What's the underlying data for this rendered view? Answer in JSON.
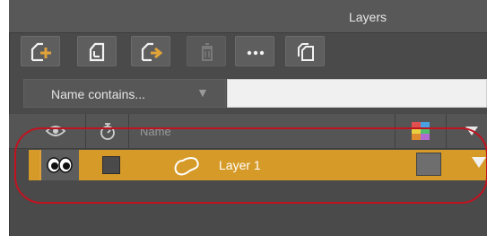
{
  "panel": {
    "title": "Layers"
  },
  "toolbar": {
    "buttons": [
      {
        "name": "new-layer",
        "icon": "new-layer-icon"
      },
      {
        "name": "duplicate-layer",
        "icon": "duplicate-layer-icon"
      },
      {
        "name": "move-layer",
        "icon": "move-layer-icon"
      },
      {
        "name": "delete-layer",
        "icon": "trash-icon",
        "disabled": true
      },
      {
        "name": "more-options",
        "icon": "ellipsis-icon"
      },
      {
        "name": "copy-layer",
        "icon": "copy-icon"
      }
    ]
  },
  "filter": {
    "mode_label": "Name contains...",
    "search_value": ""
  },
  "columns": {
    "name": "Name"
  },
  "layers": [
    {
      "name": "Layer 1",
      "visible": true,
      "selected": true
    }
  ],
  "colors": {
    "panel_bg": "#4a4a4a",
    "selected_row": "#d59a27",
    "highlight": "#c0131f",
    "accent": "#e0a33a"
  }
}
